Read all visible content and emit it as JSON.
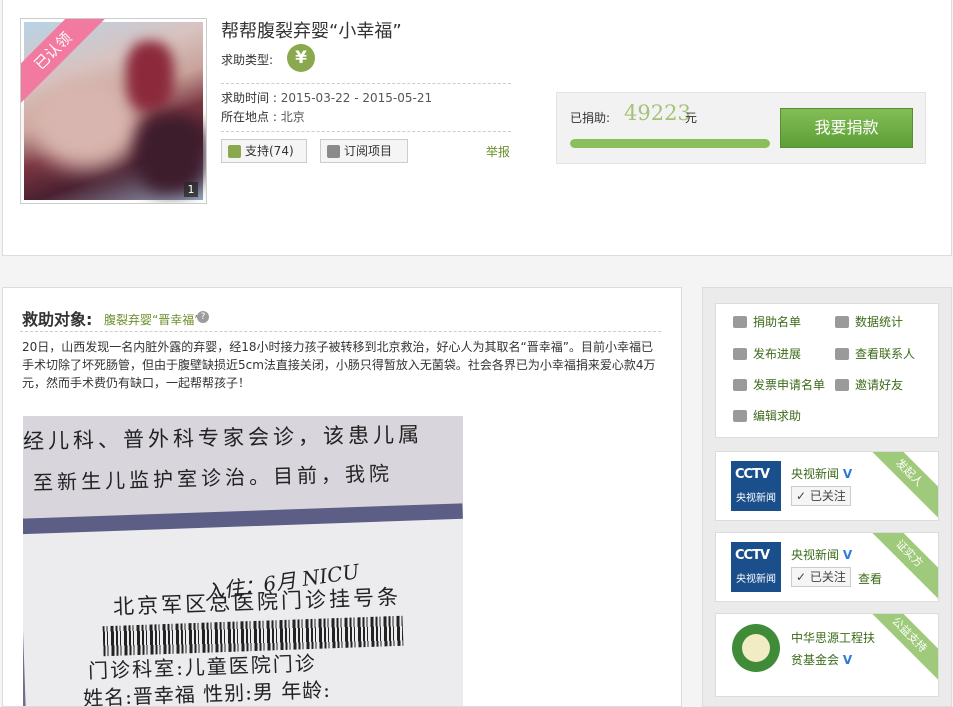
{
  "project": {
    "badge": "已认领",
    "image_count": "1",
    "title": "帮帮腹裂弃婴“小幸福”",
    "type_label": "求助类型:",
    "type_icon": "yen-icon",
    "time_label": "求助时间 :",
    "time_value": "2015-03-22 - 2015-05-21",
    "place_label": "所在地点 :",
    "place_value": "北京",
    "support_label": "支持(74)",
    "subscribe_label": "订阅项目",
    "report_label": "举报"
  },
  "donation": {
    "raised_label": "已捐助:",
    "raised_amount": "49223",
    "raised_unit": "元",
    "progress_fraction": 1.0,
    "donate_button": "我要捐款",
    "accent_color": "#6aa842"
  },
  "content": {
    "object_label": "救助对象:",
    "object_name": "腹裂弃婴“晋幸福”",
    "description": "20日，山西发现一名内脏外露的弃婴，经18小时接力孩子被转移到北京救治，好心人为其取名“晋幸福”。目前小幸福已手术切除了坏死肠管，但由于腹壁缺损近5cm法直接关闭，小肠只得暂放入无菌袋。社会各界已为小幸福捐来爱心款4万元，然而手术费仍有缺口，一起帮帮孩子！",
    "document_lines": [
      "经儿科、普外科专家会诊，该患儿属",
      "至新生儿监护室诊治。目前，我院",
      "入住：6月 NICU",
      "北京军区总医院门诊挂号条",
      "门诊科室:儿童医院门诊",
      "姓名:晋幸福   性别:男   年龄:"
    ]
  },
  "sidebar": {
    "links": [
      {
        "label": "捐助名单",
        "icon": "donor-list-icon"
      },
      {
        "label": "数据统计",
        "icon": "statistics-icon"
      },
      {
        "label": "发布进展",
        "icon": "publish-progress-icon"
      },
      {
        "label": "查看联系人",
        "icon": "contacts-icon"
      },
      {
        "label": "发票申请名单",
        "icon": "invoice-icon"
      },
      {
        "label": "邀请好友",
        "icon": "invite-icon"
      },
      {
        "label": "编辑求助",
        "icon": "edit-icon"
      }
    ],
    "orgs": [
      {
        "name": "央视新闻",
        "verified": "V",
        "follow": "已关注",
        "view": "",
        "tag": "发起人",
        "logo_text": "CCTV",
        "logo_sub": "央视新闻"
      },
      {
        "name": "央视新闻",
        "verified": "V",
        "follow": "已关注",
        "view": "查看",
        "tag": "证实方",
        "logo_text": "CCTV",
        "logo_sub": "央视新闻"
      },
      {
        "name": "中华思源工程扶贫基金会",
        "name_line1": "中华思源工程扶",
        "name_line2": "贫基金会",
        "verified": "V",
        "tag": "公益支持"
      }
    ]
  }
}
